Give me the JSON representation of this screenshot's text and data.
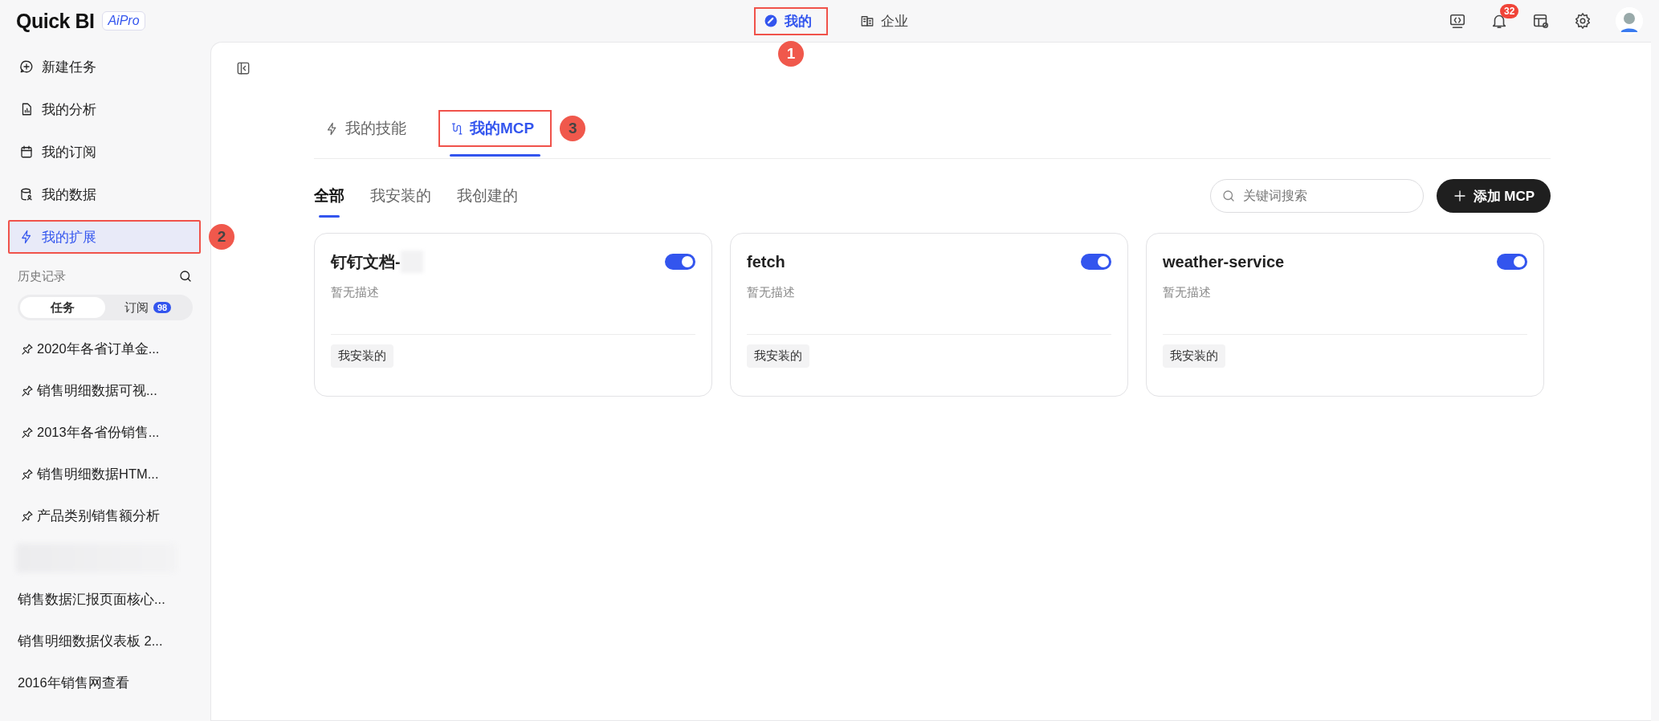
{
  "app": {
    "logo": "Quick BI",
    "badge": "AiPro"
  },
  "top_nav": [
    {
      "label": "我的",
      "selected": true,
      "callout": "1"
    },
    {
      "label": "企业",
      "selected": false
    }
  ],
  "notifications": {
    "count": "32"
  },
  "sidebar": {
    "items": [
      {
        "label": "新建任务",
        "kind": "new",
        "selected": false
      },
      {
        "label": "我的分析",
        "kind": "analysis",
        "selected": false
      },
      {
        "label": "我的订阅",
        "kind": "subscription",
        "selected": false
      },
      {
        "label": "我的数据",
        "kind": "data",
        "selected": false
      },
      {
        "label": "我的扩展",
        "kind": "extension",
        "selected": true,
        "callout": "2"
      }
    ]
  },
  "history": {
    "title": "历史记录",
    "tabs": [
      {
        "label": "任务",
        "selected": true
      },
      {
        "label": "订阅",
        "selected": false,
        "count": "98"
      }
    ],
    "items": [
      {
        "kind": "pinned",
        "label": "2020年各省订单金..."
      },
      {
        "kind": "pinned",
        "label": "销售明细数据可视..."
      },
      {
        "kind": "pinned",
        "label": "2013年各省份销售..."
      },
      {
        "kind": "pinned",
        "label": "销售明细数据HTM..."
      },
      {
        "kind": "pinned",
        "label": "产品类别销售额分析"
      },
      {
        "kind": "blurred"
      },
      {
        "kind": "plain",
        "label": "销售数据汇报页面核心..."
      },
      {
        "kind": "plain",
        "label": "销售明细数据仪表板 2..."
      },
      {
        "kind": "plain",
        "label": "2016年销售网查看"
      }
    ]
  },
  "main": {
    "tabs": [
      {
        "label": "我的技能",
        "kind": "skills",
        "selected": false
      },
      {
        "label": "我的MCP",
        "kind": "mcp",
        "selected": true,
        "callout": "3"
      }
    ],
    "filters": [
      {
        "label": "全部",
        "selected": true
      },
      {
        "label": "我安装的",
        "selected": false
      },
      {
        "label": "我创建的",
        "selected": false
      }
    ],
    "search": {
      "placeholder": "关键词搜索"
    },
    "add_button": "添加 MCP",
    "cards": [
      {
        "title": "钉钉文档-",
        "title_blurred": true,
        "on": true,
        "description": "暂无描述",
        "tag": "我安装的"
      },
      {
        "title": "fetch",
        "title_blurred": false,
        "on": true,
        "description": "暂无描述",
        "tag": "我安装的"
      },
      {
        "title": "weather-service",
        "title_blurred": false,
        "on": true,
        "description": "暂无描述",
        "tag": "我安装的"
      }
    ]
  }
}
